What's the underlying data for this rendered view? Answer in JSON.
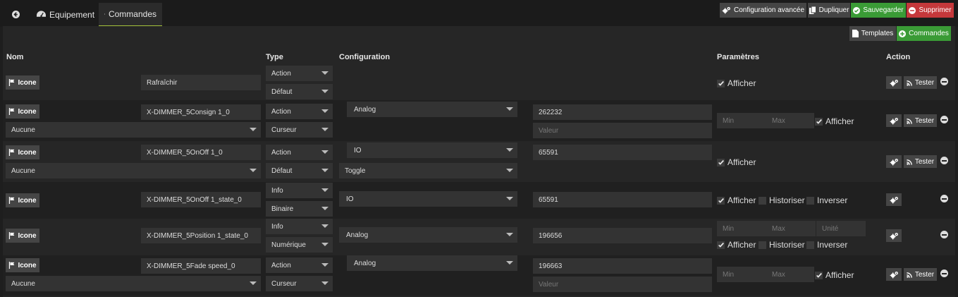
{
  "tabs": {
    "back_icon": "arrow-circle-left-icon",
    "equipement": "Equipement",
    "commandes": "Commandes"
  },
  "toolbar": {
    "config_avancee": "Configuration avancée",
    "dupliquer": "Dupliquer",
    "sauvegarder": "Sauvegarder",
    "supprimer": "Supprimer",
    "templates": "Templates",
    "commandes": "Commandes"
  },
  "colors": {
    "accent": "#a5c23c",
    "green": "#3a9b36",
    "red": "#c5383b"
  },
  "table": {
    "headers": {
      "nom": "Nom",
      "type": "Type",
      "configuration": "Configuration",
      "parametres": "Paramètres",
      "action": "Action"
    },
    "icon_label": "Icone",
    "tester_label": "Tester",
    "afficher": "Afficher",
    "historiser": "Historiser",
    "inverser": "Inverser",
    "min_ph": "Min",
    "max_ph": "Max",
    "unite_ph": "Unité",
    "valeur_ph": "Valeur",
    "rows": [
      {
        "name": "Rafraîchir",
        "type": "Action",
        "subtype": "Défaut"
      },
      {
        "name": "X-DIMMER_5Consign 1_0",
        "type": "Action",
        "subtype": "Curseur",
        "value_cmd": "Aucune",
        "config": "Analog",
        "address": "262232"
      },
      {
        "name": "X-DIMMER_5OnOff 1_0",
        "type": "Action",
        "subtype": "Défaut",
        "value_cmd": "Aucune",
        "config": "IO",
        "config2": "Toggle",
        "address": "65591"
      },
      {
        "name": "X-DIMMER_5OnOff 1_state_0",
        "type": "Info",
        "subtype": "Binaire",
        "config": "IO",
        "address": "65591"
      },
      {
        "name": "X-DIMMER_5Position 1_state_0",
        "type": "Info",
        "subtype": "Numérique",
        "config": "Analog",
        "address": "196656"
      },
      {
        "name": "X-DIMMER_5Fade speed_0",
        "type": "Action",
        "subtype": "Curseur",
        "value_cmd": "Aucune",
        "config": "Analog",
        "address": "196663"
      }
    ]
  }
}
